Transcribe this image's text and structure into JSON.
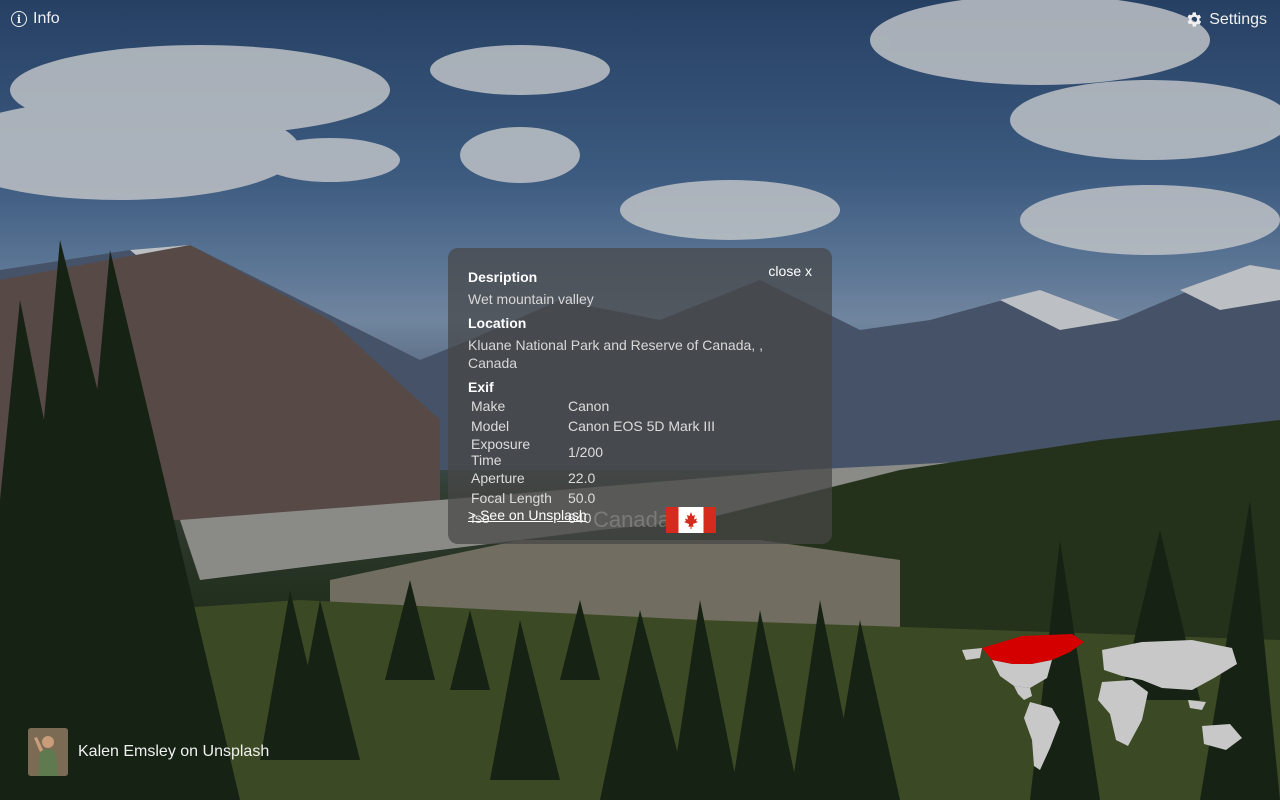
{
  "header": {
    "info_label": "Info",
    "settings_label": "Settings",
    "info_icon": "info-icon",
    "settings_icon": "gear-icon"
  },
  "panel": {
    "close_label": "close x",
    "description_title": "Desription",
    "description_value": "Wet mountain valley",
    "location_title": "Location",
    "location_value": "Kluane National Park and Reserve of Canada, , Canada",
    "exif_title": "Exif",
    "exif": [
      {
        "key": "Make",
        "value": "Canon"
      },
      {
        "key": "Model",
        "value": "Canon EOS 5D Mark III"
      },
      {
        "key": "Exposure Time",
        "value": "1/200"
      },
      {
        "key": "Aperture",
        "value": "22.0"
      },
      {
        "key": "Focal Length",
        "value": "50.0"
      },
      {
        "key": "Iso",
        "value": "640"
      }
    ],
    "unsplash_link": "> See on Unsplash",
    "country": "Canada"
  },
  "credit": {
    "label": "Kalen Emsley on Unsplash"
  },
  "colors": {
    "panel_bg": "#464646",
    "flag_red": "#d52b1e",
    "map_highlight": "#d40000",
    "map_land": "#c8c8c8"
  }
}
